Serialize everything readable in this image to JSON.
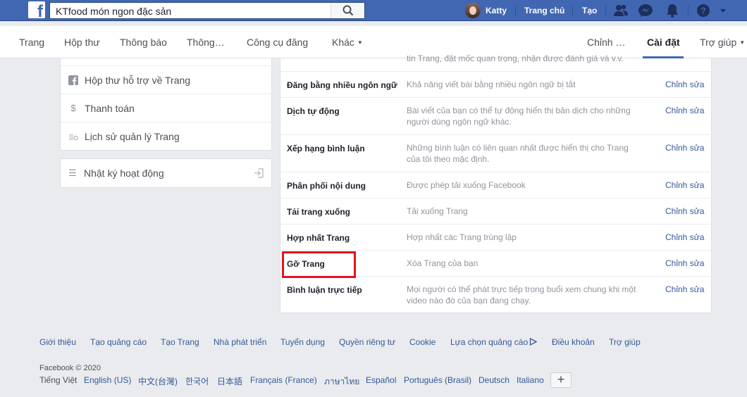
{
  "topbar": {
    "search_value": "KTfood món ngon đặc sản",
    "user_name": "Katty",
    "home_label": "Trang chủ",
    "create_label": "Tạo"
  },
  "pagenav": {
    "items": [
      "Trang",
      "Hộp thư",
      "Thông báo",
      "Thông…",
      "Công cụ đăng",
      "Khác"
    ],
    "right_items": [
      "Chỉnh …",
      "Cài đặt",
      "Trợ giúp"
    ]
  },
  "sidebar": {
    "items": [
      {
        "label": "Hộp thư hỗ trợ về Trang",
        "icon": "facebook-square-icon"
      },
      {
        "label": "Thanh toán",
        "icon": "dollar-icon"
      },
      {
        "label": "Lịch sử quản lý Trang",
        "icon": "history-gear-icon"
      }
    ],
    "activity_log": "Nhật ký hoạt động"
  },
  "settings": {
    "clipped_top_text": "tin Trang, đặt mốc quan trọng, nhận được đánh giá và v.v.",
    "rows": [
      {
        "name": "Đăng bằng nhiều ngôn ngữ",
        "desc": "Khả năng viết bài bằng nhiều ngôn ngữ bị tắt",
        "edit": "Chỉnh sửa"
      },
      {
        "name": "Dịch tự động",
        "desc": "Bài viết của bạn có thể tự động hiển thị bản dịch cho những người dùng ngôn ngữ khác.",
        "edit": "Chỉnh sửa"
      },
      {
        "name": "Xếp hạng bình luận",
        "desc": "Những bình luận có liên quan nhất được hiển thị cho Trang của tôi theo mặc định.",
        "edit": "Chỉnh sửa"
      },
      {
        "name": "Phân phối nội dung",
        "desc": "Được phép tải xuống Facebook",
        "edit": "Chỉnh sửa"
      },
      {
        "name": "Tải trang xuống",
        "desc": "Tải xuống Trang",
        "edit": "Chỉnh sửa"
      },
      {
        "name": "Hợp nhất Trang",
        "desc": "Hợp nhất các Trang trùng lặp",
        "edit": "Chỉnh sửa"
      },
      {
        "name": "Gỡ Trang",
        "desc": "Xóa Trang của bạn",
        "edit": "Chỉnh sửa"
      },
      {
        "name": "Bình luận trực tiếp",
        "desc": "Mọi người có thể phát trực tiếp trong buổi xem chung khi một video nào đó của bạn đang chạy.",
        "edit": "Chỉnh sửa"
      }
    ]
  },
  "footer": {
    "links": [
      "Giới thiệu",
      "Tạo quảng cáo",
      "Tạo Trang",
      "Nhà phát triển",
      "Tuyển dụng",
      "Quyền riêng tư",
      "Cookie",
      "Lựa chọn quảng cáo",
      "Điều khoản",
      "Trợ giúp"
    ],
    "copyright": "Facebook © 2020",
    "languages": [
      "Tiếng Việt",
      "English (US)",
      "中文(台灣)",
      "한국어",
      "日本語",
      "Français (France)",
      "ภาษาไทย",
      "Español",
      "Português (Brasil)",
      "Deutsch",
      "Italiano"
    ],
    "plus": "+"
  },
  "colors": {
    "brand": "#4267b2",
    "link": "#365899",
    "highlight": "#e0141e"
  }
}
